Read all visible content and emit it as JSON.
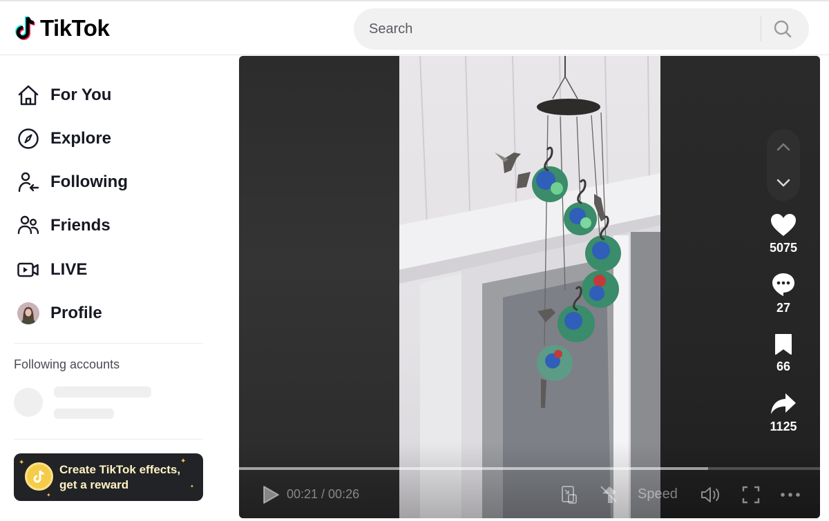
{
  "brand": {
    "name": "TikTok"
  },
  "search": {
    "placeholder": "Search"
  },
  "sidebar": {
    "items": [
      {
        "label": "For You",
        "icon": "home-icon"
      },
      {
        "label": "Explore",
        "icon": "compass-icon"
      },
      {
        "label": "Following",
        "icon": "user-following-icon"
      },
      {
        "label": "Friends",
        "icon": "friends-icon"
      },
      {
        "label": "LIVE",
        "icon": "live-camera-icon"
      },
      {
        "label": "Profile",
        "icon": "avatar"
      }
    ],
    "following_accounts_title": "Following accounts",
    "promo": {
      "line1": "Create TikTok effects,",
      "line2": "get a reward"
    }
  },
  "video": {
    "actions": {
      "likes": "5075",
      "comments": "27",
      "saves": "66",
      "shares": "1125"
    },
    "player": {
      "current_time": "00:21",
      "duration": "00:26",
      "time_display": "00:21 / 00:26",
      "progress_fraction": 0.807,
      "speed_label": "Speed"
    }
  },
  "colors": {
    "brand_cyan": "#25f4ee",
    "brand_pink": "#fe2c55",
    "promo_gold": "#f4cc4a"
  }
}
